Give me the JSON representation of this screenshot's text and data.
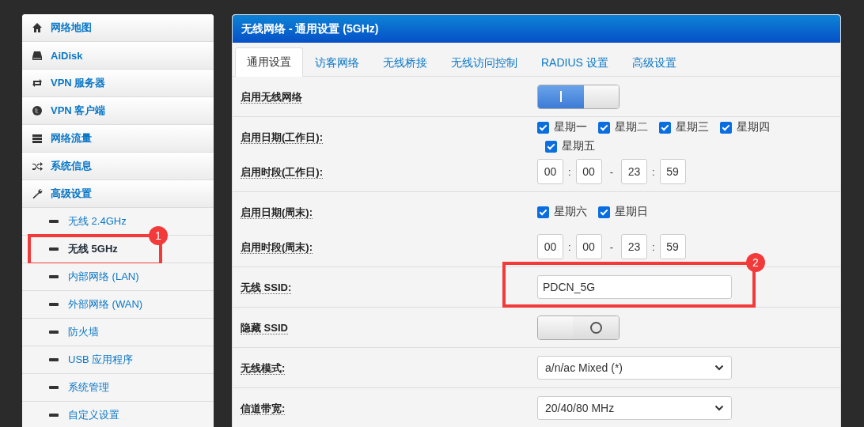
{
  "sidebar": {
    "items": [
      {
        "label": "网络地图",
        "selected": false
      },
      {
        "label": "AiDisk",
        "selected": false
      },
      {
        "label": "VPN 服务器",
        "selected": false
      },
      {
        "label": "VPN 客户端",
        "selected": false
      },
      {
        "label": "网络流量",
        "selected": false
      },
      {
        "label": "系统信息",
        "selected": false
      },
      {
        "label": "高级设置",
        "selected": false,
        "children": [
          {
            "label": "无线 2.4GHz",
            "selected": false
          },
          {
            "label": "无线 5GHz",
            "selected": true,
            "annotation": "1"
          },
          {
            "label": "内部网络 (LAN)",
            "selected": false
          },
          {
            "label": "外部网络 (WAN)",
            "selected": false
          },
          {
            "label": "防火墙",
            "selected": false
          },
          {
            "label": "USB 应用程序",
            "selected": false
          },
          {
            "label": "系统管理",
            "selected": false
          },
          {
            "label": "自定义设置",
            "selected": false
          }
        ]
      }
    ]
  },
  "panel": {
    "title": "无线网络 - 通用设置 (5GHz)",
    "tabs": [
      {
        "label": "通用设置",
        "selected": true
      },
      {
        "label": "访客网络",
        "selected": false
      },
      {
        "label": "无线桥接",
        "selected": false
      },
      {
        "label": "无线访问控制",
        "selected": false
      },
      {
        "label": "RADIUS 设置",
        "selected": false
      },
      {
        "label": "高级设置",
        "selected": false
      }
    ],
    "sections": [
      {
        "rows": [
          {
            "kind": "toggle",
            "label": "启用无线网络",
            "on": true
          }
        ]
      },
      {
        "rows": [
          {
            "kind": "days",
            "label": "启用日期(工作日):",
            "days": [
              {
                "label": "星期一",
                "checked": true
              },
              {
                "label": "星期二",
                "checked": true
              },
              {
                "label": "星期三",
                "checked": true
              },
              {
                "label": "星期四",
                "checked": true
              },
              {
                "label": "星期五",
                "checked": true
              }
            ]
          },
          {
            "kind": "time",
            "label": "启用时段(工作日):",
            "parts": [
              {
                "kind": "field",
                "text": "00"
              },
              {
                "kind": "sep",
                "text": ":"
              },
              {
                "kind": "field",
                "text": "00"
              },
              {
                "kind": "sep",
                "text": "-"
              },
              {
                "kind": "field",
                "text": "23"
              },
              {
                "kind": "sep",
                "text": ":"
              },
              {
                "kind": "field",
                "text": "59"
              }
            ]
          }
        ]
      },
      {
        "rows": [
          {
            "kind": "days",
            "label": "启用日期(周末):",
            "days": [
              {
                "label": "星期六",
                "checked": true
              },
              {
                "label": "星期日",
                "checked": true
              }
            ]
          },
          {
            "kind": "time",
            "label": "启用时段(周末):",
            "parts": [
              {
                "kind": "field",
                "text": "00"
              },
              {
                "kind": "sep",
                "text": ":"
              },
              {
                "kind": "field",
                "text": "00"
              },
              {
                "kind": "sep",
                "text": "-"
              },
              {
                "kind": "field",
                "text": "23"
              },
              {
                "kind": "sep",
                "text": ":"
              },
              {
                "kind": "field",
                "text": "59"
              }
            ]
          }
        ]
      },
      {
        "rows": [
          {
            "kind": "text",
            "label": "无线 SSID:",
            "value": "PDCN_5G",
            "annotation": "2"
          }
        ]
      },
      {
        "rows": [
          {
            "kind": "toggle",
            "label": "隐藏 SSID",
            "on": false
          }
        ]
      },
      {
        "rows": [
          {
            "kind": "select",
            "label": "无线模式:",
            "value": "a/n/ac Mixed (*)"
          }
        ]
      },
      {
        "rows": [
          {
            "kind": "select",
            "label": "信道带宽:",
            "value": "20/40/80 MHz"
          }
        ]
      }
    ]
  }
}
